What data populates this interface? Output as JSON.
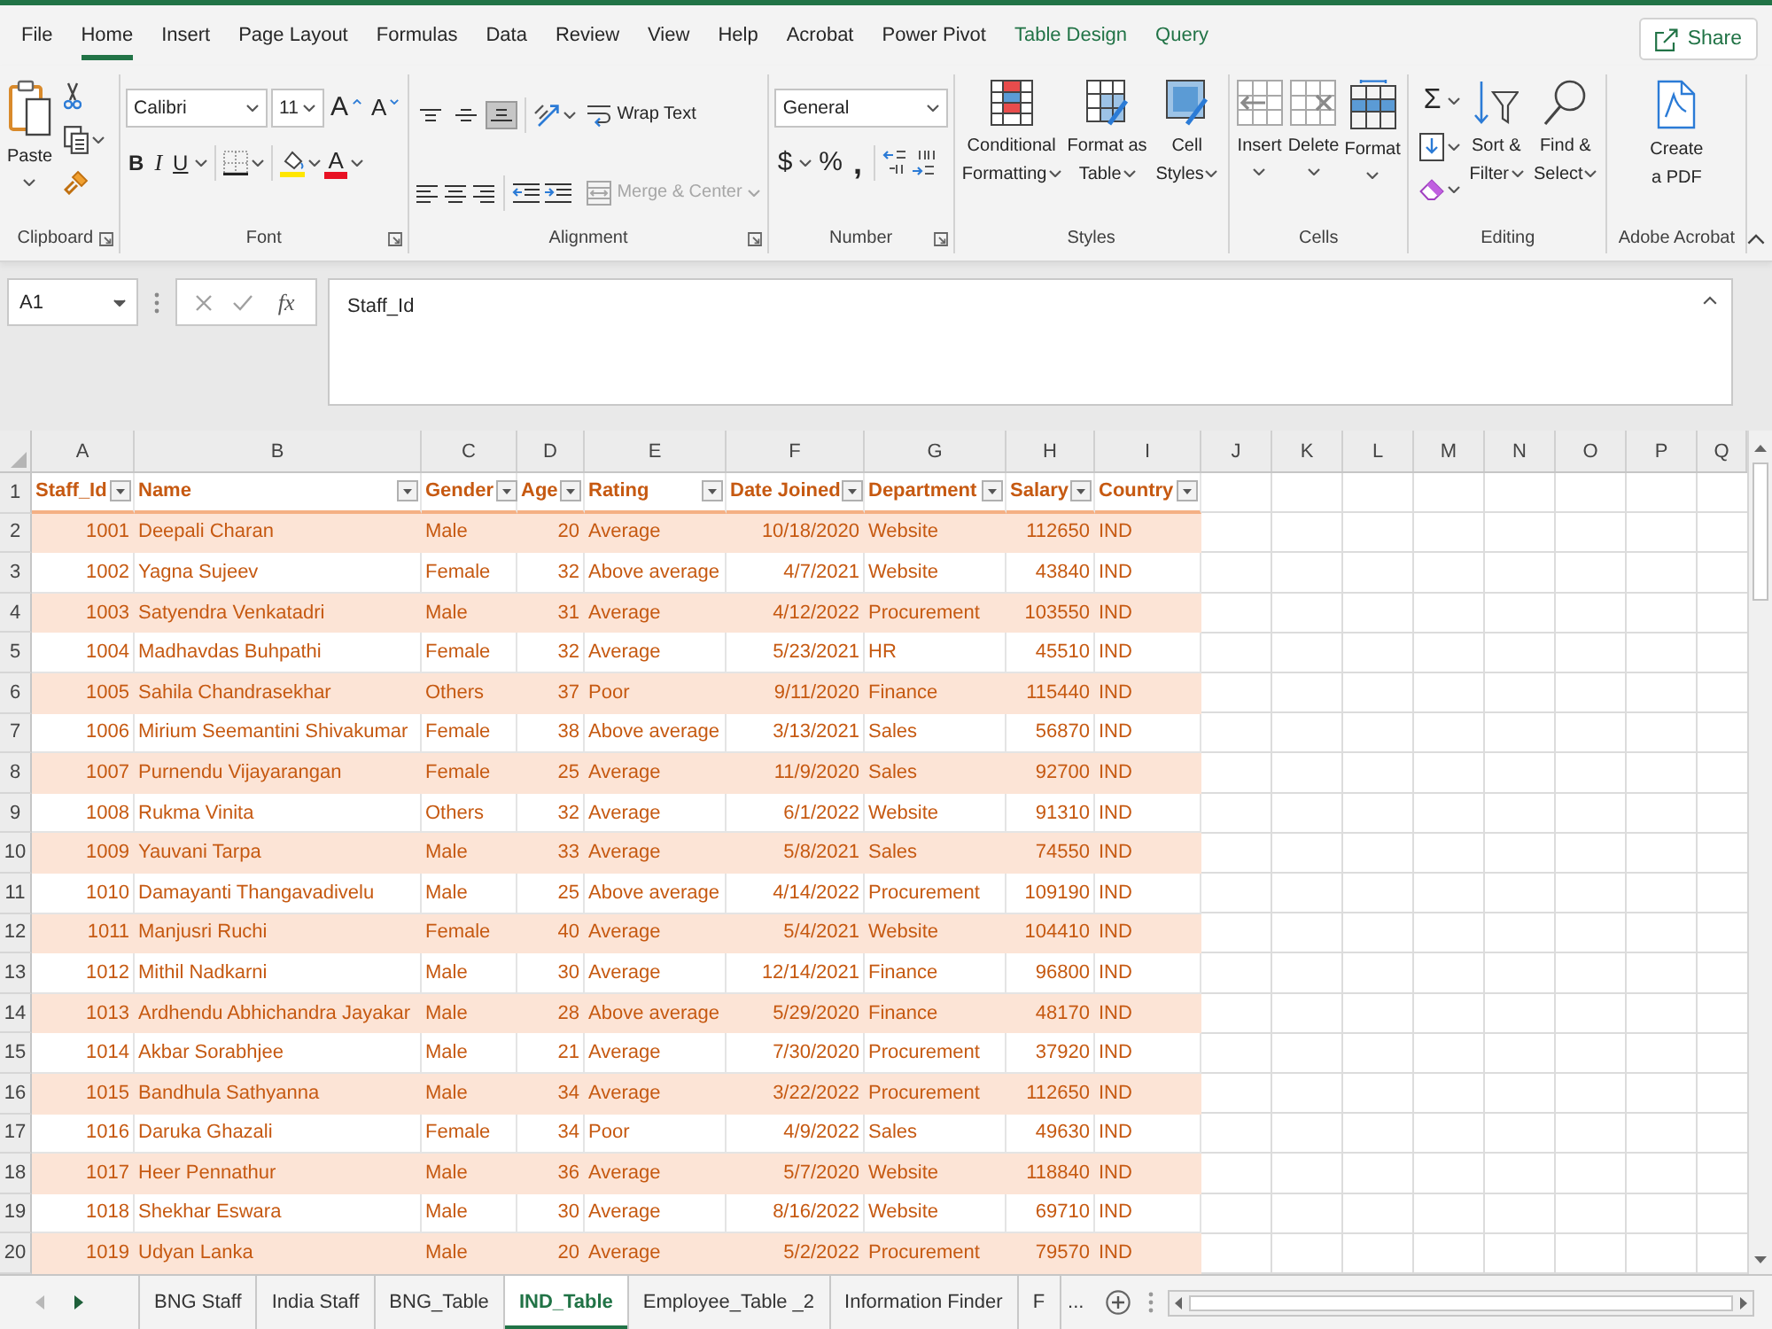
{
  "tabs": [
    {
      "label": "File",
      "selected": false,
      "kind": "standard"
    },
    {
      "label": "Home",
      "selected": true,
      "kind": "standard"
    },
    {
      "label": "Insert",
      "selected": false,
      "kind": "standard"
    },
    {
      "label": "Page Layout",
      "selected": false,
      "kind": "standard"
    },
    {
      "label": "Formulas",
      "selected": false,
      "kind": "standard"
    },
    {
      "label": "Data",
      "selected": false,
      "kind": "standard"
    },
    {
      "label": "Review",
      "selected": false,
      "kind": "standard"
    },
    {
      "label": "View",
      "selected": false,
      "kind": "standard"
    },
    {
      "label": "Help",
      "selected": false,
      "kind": "standard"
    },
    {
      "label": "Acrobat",
      "selected": false,
      "kind": "standard"
    },
    {
      "label": "Power Pivot",
      "selected": false,
      "kind": "standard"
    },
    {
      "label": "Table Design",
      "selected": false,
      "kind": "contextual"
    },
    {
      "label": "Query",
      "selected": false,
      "kind": "contextual"
    }
  ],
  "share_button": {
    "label": "Share"
  },
  "ribbon": {
    "clipboard": {
      "title": "Clipboard",
      "paste": "Paste"
    },
    "font": {
      "title": "Font",
      "font_name": "Calibri",
      "font_size": "11",
      "grow_font": "A",
      "shrink_font": "A",
      "bold": "B",
      "italic": "I",
      "underline": "U",
      "font_color": "A"
    },
    "alignment": {
      "title": "Alignment",
      "vertical_align": [
        {
          "selected": false
        },
        {
          "selected": false
        },
        {
          "selected": true
        }
      ],
      "wrap_text": "Wrap Text",
      "merge_center": {
        "label": "Merge & Center",
        "disabled": true
      }
    },
    "number": {
      "title": "Number",
      "format": "General",
      "currency": "$",
      "percent": "%",
      "comma": ","
    },
    "styles": {
      "title": "Styles",
      "buttons": [
        "Conditional Formatting",
        "Format as Table",
        "Cell Styles"
      ]
    },
    "cells": {
      "title": "Cells",
      "buttons": [
        "Insert",
        "Delete",
        "Format"
      ]
    },
    "editing": {
      "title": "Editing",
      "autosum": "Σ",
      "buttons": [
        "Sort & Filter",
        "Find & Select"
      ]
    },
    "acrobat": {
      "title": "Adobe Acrobat",
      "create_pdf": "Create a PDF"
    }
  },
  "formula_bar": {
    "name_box": "A1",
    "insert_function": "fx",
    "formula": "Staff_Id"
  },
  "sheet": {
    "column_letters": [
      "A",
      "B",
      "C",
      "D",
      "E",
      "F",
      "G",
      "H",
      "I",
      "J",
      "K",
      "L",
      "M",
      "N",
      "O",
      "P",
      "Q"
    ],
    "row_numbers": [
      "1",
      "2",
      "3",
      "4",
      "5",
      "6",
      "7",
      "8",
      "9",
      "10",
      "11",
      "12",
      "13",
      "14",
      "15",
      "16",
      "17",
      "18",
      "19",
      "20"
    ],
    "table": {
      "columns": [
        {
          "name": "Staff_Id",
          "kind": "number"
        },
        {
          "name": "Name",
          "kind": "text"
        },
        {
          "name": "Gender",
          "kind": "text"
        },
        {
          "name": "Age",
          "kind": "number"
        },
        {
          "name": "Rating",
          "kind": "text"
        },
        {
          "name": "Date Joined",
          "kind": "number"
        },
        {
          "name": "Department",
          "kind": "text"
        },
        {
          "name": "Salary",
          "kind": "number"
        },
        {
          "name": "Country",
          "kind": "text"
        }
      ],
      "rows": [
        [
          "1001",
          "Deepali Charan",
          "Male",
          "20",
          "Average",
          "10/18/2020",
          "Website",
          "112650",
          "IND"
        ],
        [
          "1002",
          "Yagna Sujeev",
          "Female",
          "32",
          "Above average",
          "4/7/2021",
          "Website",
          "43840",
          "IND"
        ],
        [
          "1003",
          "Satyendra Venkatadri",
          "Male",
          "31",
          "Average",
          "4/12/2022",
          "Procurement",
          "103550",
          "IND"
        ],
        [
          "1004",
          "Madhavdas Buhpathi",
          "Female",
          "32",
          "Average",
          "5/23/2021",
          "HR",
          "45510",
          "IND"
        ],
        [
          "1005",
          "Sahila Chandrasekhar",
          "Others",
          "37",
          "Poor",
          "9/11/2020",
          "Finance",
          "115440",
          "IND"
        ],
        [
          "1006",
          "Mirium Seemantini Shivakumar",
          "Female",
          "38",
          "Above average",
          "3/13/2021",
          "Sales",
          "56870",
          "IND"
        ],
        [
          "1007",
          "Purnendu Vijayarangan",
          "Female",
          "25",
          "Average",
          "11/9/2020",
          "Sales",
          "92700",
          "IND"
        ],
        [
          "1008",
          "Rukma Vinita",
          "Others",
          "32",
          "Average",
          "6/1/2022",
          "Website",
          "91310",
          "IND"
        ],
        [
          "1009",
          "Yauvani Tarpa",
          "Male",
          "33",
          "Average",
          "5/8/2021",
          "Sales",
          "74550",
          "IND"
        ],
        [
          "1010",
          "Damayanti Thangavadivelu",
          "Male",
          "25",
          "Above average",
          "4/14/2022",
          "Procurement",
          "109190",
          "IND"
        ],
        [
          "1011",
          "Manjusri Ruchi",
          "Female",
          "40",
          "Average",
          "5/4/2021",
          "Website",
          "104410",
          "IND"
        ],
        [
          "1012",
          "Mithil Nadkarni",
          "Male",
          "30",
          "Average",
          "12/14/2021",
          "Finance",
          "96800",
          "IND"
        ],
        [
          "1013",
          "Ardhendu Abhichandra Jayakar",
          "Male",
          "28",
          "Above average",
          "5/29/2020",
          "Finance",
          "48170",
          "IND"
        ],
        [
          "1014",
          "Akbar Sorabhjee",
          "Male",
          "21",
          "Average",
          "7/30/2020",
          "Procurement",
          "37920",
          "IND"
        ],
        [
          "1015",
          "Bandhula Sathyanna",
          "Male",
          "34",
          "Average",
          "3/22/2022",
          "Procurement",
          "112650",
          "IND"
        ],
        [
          "1016",
          "Daruka Ghazali",
          "Female",
          "34",
          "Poor",
          "4/9/2022",
          "Sales",
          "49630",
          "IND"
        ],
        [
          "1017",
          "Heer Pennathur",
          "Male",
          "36",
          "Average",
          "5/7/2020",
          "Website",
          "118840",
          "IND"
        ],
        [
          "1018",
          "Shekhar Eswara",
          "Male",
          "30",
          "Average",
          "8/16/2022",
          "Website",
          "69710",
          "IND"
        ],
        [
          "1019",
          "Udyan Lanka",
          "Male",
          "20",
          "Average",
          "5/2/2022",
          "Procurement",
          "79570",
          "IND"
        ]
      ]
    }
  },
  "sheet_tabs": {
    "tabs": [
      {
        "label": "BNG Staff",
        "selected": false
      },
      {
        "label": "India Staff",
        "selected": false
      },
      {
        "label": "BNG_Table",
        "selected": false
      },
      {
        "label": "IND_Table",
        "selected": true
      },
      {
        "label": "Employee_Table _2",
        "selected": false
      },
      {
        "label": "Information Finder",
        "selected": false
      },
      {
        "label": "F",
        "selected": false
      }
    ],
    "more": "..."
  }
}
